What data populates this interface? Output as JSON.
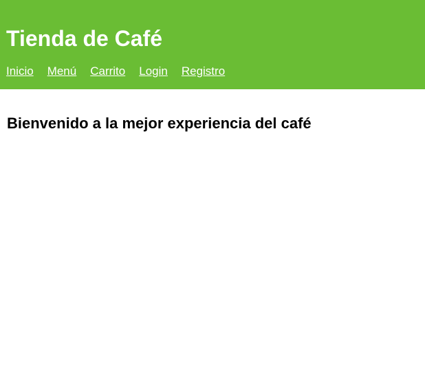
{
  "header": {
    "title": "Tienda de Café",
    "background_color": "#6abd34"
  },
  "nav": {
    "items": [
      {
        "label": "Inicio"
      },
      {
        "label": "Menú"
      },
      {
        "label": "Carrito"
      },
      {
        "label": "Login"
      },
      {
        "label": "Registro"
      }
    ]
  },
  "main": {
    "heading": "Bienvenido a la mejor experiencia del café"
  }
}
